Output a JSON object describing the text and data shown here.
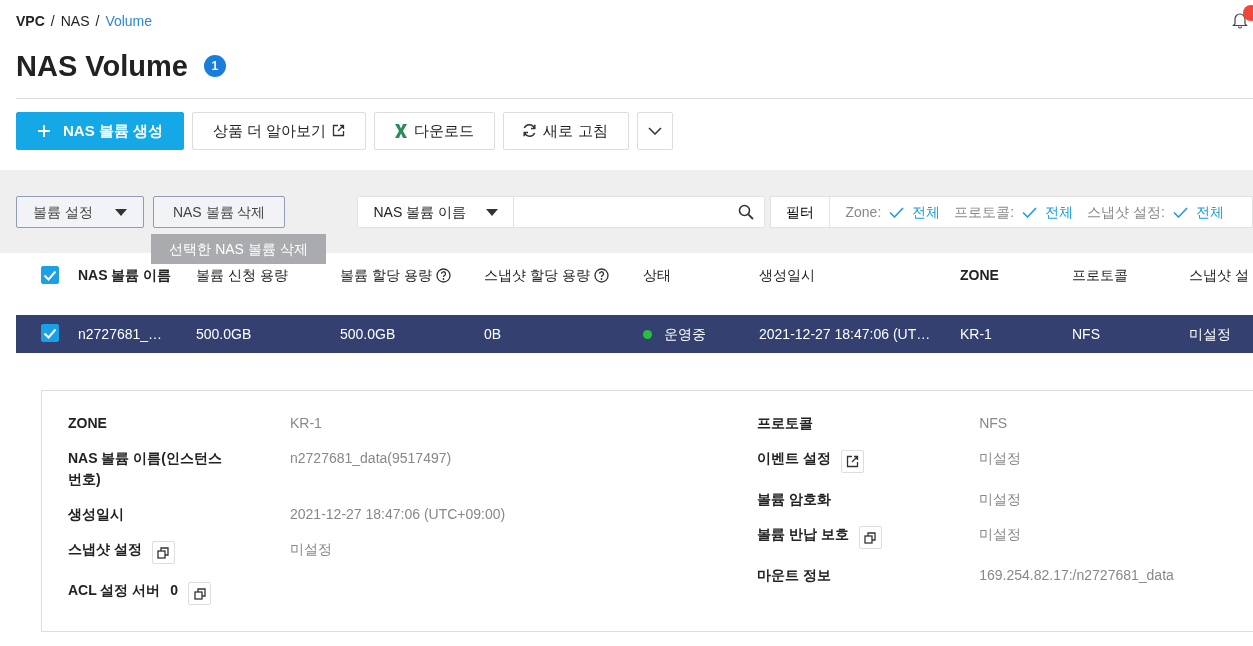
{
  "breadcrumb": [
    {
      "label": "VPC",
      "current": false
    },
    {
      "label": "NAS",
      "current": false
    },
    {
      "label": "Volume",
      "current": true
    }
  ],
  "breadcrumb_separator": "/",
  "notifications": {
    "has_unread": true
  },
  "page_title": "NAS Volume",
  "count_badge": "1",
  "actions": [
    {
      "label": "NAS 볼륨 생성",
      "kind": "primary"
    },
    {
      "label": "상품 더 알아보기",
      "kind": "external"
    },
    {
      "label": "다운로드",
      "kind": "excel"
    },
    {
      "label": "새로 고침",
      "kind": "refresh"
    },
    {
      "kind": "more"
    }
  ],
  "toolbar": {
    "settings_dropdown": "볼륨 설정",
    "delete_button": "NAS 볼륨 삭제",
    "search_field_select": "NAS 볼륨 이름",
    "filter_button": "필터",
    "filters": [
      {
        "label": "Zone:",
        "value": "전체"
      },
      {
        "label": "프로토콜:",
        "value": "전체"
      },
      {
        "label": "스냅샷 설정:",
        "value": "전체"
      }
    ]
  },
  "tooltip": "선택한 NAS 볼륨 삭제",
  "table": {
    "all_checked": true,
    "columns": [
      {
        "label": "NAS 볼륨 이름",
        "help": false
      },
      {
        "label": "볼륨 신청 용량",
        "help": false
      },
      {
        "label": "볼륨 할당 용량",
        "help": true
      },
      {
        "label": "스냅샷 할당 용량",
        "help": true
      },
      {
        "label": "상태",
        "help": false
      },
      {
        "label": "생성일시",
        "help": false
      },
      {
        "label": "ZONE",
        "help": false
      },
      {
        "label": "프로토콜",
        "help": false
      },
      {
        "label": "스냅샷 설",
        "help": false
      }
    ],
    "rows": [
      {
        "selected": true,
        "checked": true,
        "color": "#22c43a",
        "cells": [
          "n2727681_…",
          "500.0GB",
          "500.0GB",
          "0B",
          "운영중",
          "2021-12-27 18:47:06 (UT…",
          "KR-1",
          "NFS",
          "미설정"
        ]
      }
    ]
  },
  "details": {
    "left": [
      {
        "label": "ZONE",
        "value": "KR-1"
      },
      {
        "label": "NAS 볼륨 이름(인스턴스 번호)",
        "value": "n2727681_data(9517497)"
      },
      {
        "label": "생성일시",
        "value": "2021-12-27 18:47:06 (UTC+09:00)"
      },
      {
        "label": "스냅샷 설정",
        "kind": "copyable",
        "value": "미설정"
      },
      {
        "label": "ACL 설정 서버",
        "count": "0",
        "kind": "copyable"
      }
    ],
    "right": [
      {
        "label": "프로토콜",
        "value": "NFS"
      },
      {
        "label": "이벤트 설정",
        "kind": "linked",
        "value": "미설정"
      },
      {
        "label": "볼륨 암호화",
        "value": "미설정"
      },
      {
        "label": "볼륨 반납 보호",
        "kind": "copyable",
        "value": "미설정"
      },
      {
        "label": "마운트 정보",
        "value": "169.254.82.17:/n2727681_data"
      }
    ]
  }
}
